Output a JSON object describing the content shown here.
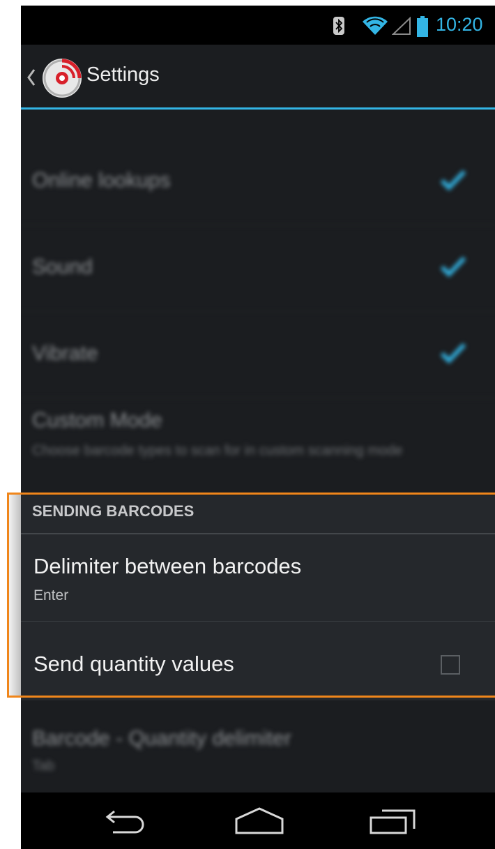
{
  "status_bar": {
    "time": "10:20",
    "icons": [
      "bluetooth-icon",
      "wifi-icon",
      "signal-icon",
      "battery-icon"
    ],
    "time_color": "#33b5e5"
  },
  "action_bar": {
    "title": "Settings",
    "logo": "barcode-scanner-logo-icon",
    "accent_color": "#33b5e5"
  },
  "blurred_preferences": [
    {
      "title": "Online lookups",
      "checked": true
    },
    {
      "title": "Sound",
      "checked": true
    },
    {
      "title": "Vibrate",
      "checked": true
    },
    {
      "title": "Custom Mode",
      "summary": "Choose barcode types to scan for in custom scanning mode"
    }
  ],
  "sending_section": {
    "header": "SENDING BARCODES",
    "items": [
      {
        "title": "Delimiter between barcodes",
        "summary": "Enter"
      },
      {
        "title": "Send quantity values",
        "checked": false
      }
    ]
  },
  "blurred_bottom_item": {
    "title": "Barcode - Quantity delimiter",
    "summary": "Tab"
  },
  "highlight_color": "#f0861b",
  "nav_bar": [
    "back-icon",
    "home-icon",
    "recent-apps-icon"
  ]
}
